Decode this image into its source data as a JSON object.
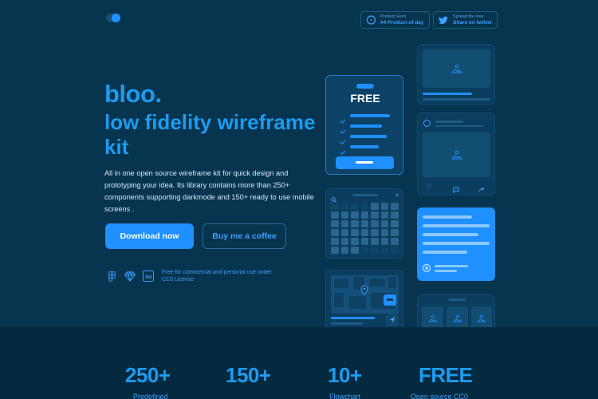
{
  "topbar": {
    "product_hunt_line1": "Product Hunt",
    "product_hunt_line2": "#4 Product of day",
    "share_line1": "Spread the love",
    "share_line2": "Share on twitter"
  },
  "hero": {
    "brand": "bloo.",
    "headline": "low fidelity wireframe kit",
    "description": "All in one open source wireframe kit for quick design and prototyping your idea. Its library contains more than 250+ components supporting darkmode and 150+ ready to use mobile screens .",
    "primary_button": "Download now",
    "secondary_button": "Buy me a coffee",
    "license": "Free for commercial and personal use under CC0 License",
    "tool_icons": [
      "figma-icon",
      "sketch-icon",
      "xd-icon"
    ]
  },
  "pricing_card": {
    "title": "FREE"
  },
  "stats": [
    {
      "number": "250+",
      "label": "Predefined"
    },
    {
      "number": "150+",
      "label": ""
    },
    {
      "number": "10+",
      "label": "Flowchart"
    },
    {
      "number": "FREE",
      "label": "Open source CC0"
    }
  ],
  "colors": {
    "background": "#07344f",
    "accent": "#1e90ff",
    "footer": "#052a40"
  }
}
